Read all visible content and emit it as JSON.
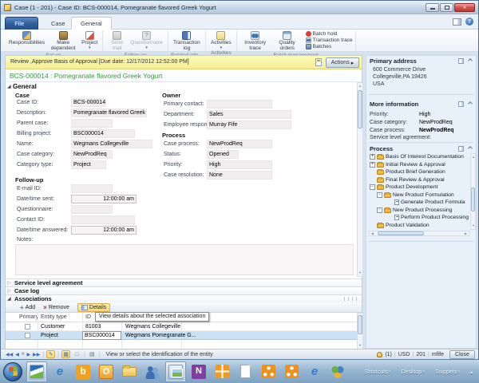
{
  "window": {
    "title": "Case (1 - 201) - Case ID: BCS-000014, Pomegranate flavored Greek Yogurt",
    "file_tab": "File",
    "tabs": [
      "Case",
      "General"
    ]
  },
  "ribbon": {
    "groups": [
      {
        "label": "Set up"
      },
      {
        "label": "Follow up"
      },
      {
        "label": "Related info..."
      },
      {
        "label": "Activities"
      },
      {
        "label": "Batch management"
      }
    ],
    "buttons": {
      "responsibilities": "Responsibilities",
      "make_dependent": "Make dependent",
      "project": "Project",
      "send_mail": "Send mail",
      "questionnaire": "Questionnaire",
      "transaction_log": "Transaction log",
      "activities": "Activities",
      "inventory_trace": "Inventory trace",
      "quality_orders": "Quality orders",
      "batch_hold": "Batch hold",
      "transaction_trace": "Transaction trace",
      "batches": "Batches"
    }
  },
  "alert": {
    "message": "Review ,Approve Basis of Approval  [Due date: 12/17/2012 12:52:00 PM]",
    "actions_label": "Actions"
  },
  "record_title": "BCS-000014 : Pomegranate flavored Greek Yogurt",
  "form": {
    "section_title": "General",
    "case_group": {
      "title": "Case",
      "fields": [
        {
          "label": "Case ID:",
          "value": "BCS-000014"
        },
        {
          "label": "Description:",
          "value": "Pomegranate flavored Greek Yogur"
        },
        {
          "label": "Parent case:",
          "value": ""
        },
        {
          "label": "Billing project:",
          "value": "BSC000014"
        },
        {
          "label": "Name:",
          "value": "Wegmans Collegeville"
        },
        {
          "label": "Case category:",
          "value": "NewProdReq"
        },
        {
          "label": "Category type:",
          "value": "Project"
        }
      ]
    },
    "owner_group": {
      "title": "Owner",
      "fields": [
        {
          "label": "Primary contact:",
          "value": ""
        },
        {
          "label": "Department:",
          "value": "Sales"
        },
        {
          "label": "Employee responsible:",
          "value": "Murray Fife"
        }
      ]
    },
    "process_group": {
      "title": "Process",
      "fields": [
        {
          "label": "Case process:",
          "value": "NewProdReq"
        },
        {
          "label": "Status:",
          "value": "Opened"
        },
        {
          "label": "Priority:",
          "value": "High"
        },
        {
          "label": "Case resolution:",
          "value": "None"
        }
      ]
    },
    "followup_group": {
      "title": "Follow-up",
      "fields": [
        {
          "label": "E-mail ID:",
          "value": ""
        },
        {
          "label": "Date/time sent:",
          "value": "12:00:00 am"
        },
        {
          "label": "Questionnaire:",
          "value": ""
        },
        {
          "label": "Contact ID:",
          "value": ""
        },
        {
          "label": "Date/time answered:",
          "value": "12:00:00 am"
        }
      ]
    },
    "notes_label": "Notes:"
  },
  "sections": {
    "service_level_agreement": "Service level agreement",
    "case_log": "Case log",
    "associations": "Associations"
  },
  "associations": {
    "add_label": "Add",
    "remove_label": "Remove",
    "details_label": "Details",
    "tooltip": "View details about the selected association",
    "columns": {
      "primary": "Primary",
      "entity_type": "Entity type",
      "id": "ID"
    },
    "rows": [
      {
        "entity_type": "Customer",
        "id": "81003",
        "name": "Wegmans Collegeville"
      },
      {
        "entity_type": "Project",
        "id": "BSC000014",
        "name": "Wegmans Pomegranate G..."
      }
    ]
  },
  "status_bar": {
    "help_text": "View or select the identification of the entity",
    "notification_count": "(1)",
    "currency": "USD",
    "company": "201",
    "user": "mfife",
    "close_label": "Close"
  },
  "factbox": {
    "primary_address": {
      "title": "Primary address",
      "line1": "600 Commerce Drive",
      "line2": "Collegeville,PA 19426",
      "line3": "USA"
    },
    "more_information": {
      "title": "More information",
      "rows": [
        {
          "label": "Priority:",
          "value": "High"
        },
        {
          "label": "Case category:",
          "value": "NewProdReq"
        },
        {
          "label": "Case process:",
          "value": "NewProdReq"
        },
        {
          "label": "Service level agreement:",
          "value": ""
        }
      ]
    },
    "process": {
      "title": "Process",
      "items": [
        "Basis Of Interest Documentation",
        "Initial Review & Approval",
        "Product Brief Generation",
        "Final Review & Approval",
        "Product Development",
        "New Product Formulation",
        "Generate Product Formula",
        "New Product Processing",
        "Perform Product Processing",
        "Product Validation"
      ]
    }
  },
  "taskbar": {
    "toolbars": [
      "Shortcuts",
      "Desktop",
      "Snippets"
    ]
  }
}
